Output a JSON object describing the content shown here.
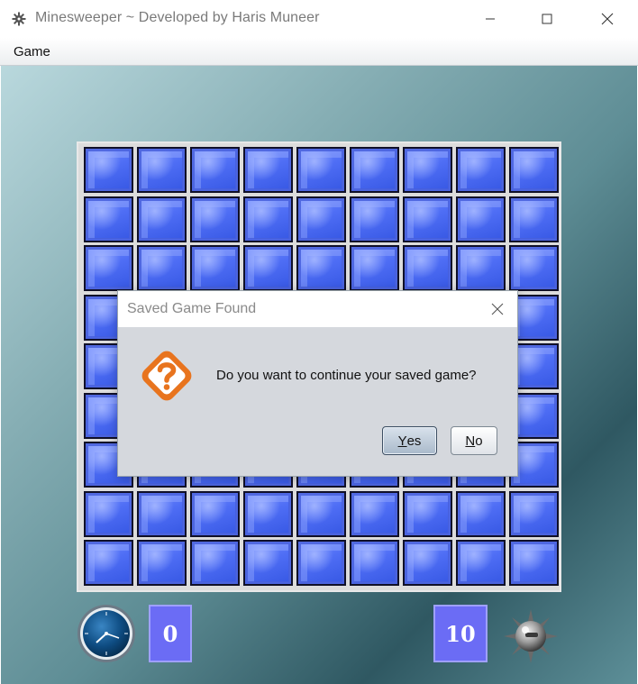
{
  "window": {
    "title": "Minesweeper ~ Developed by Haris Muneer",
    "icon": "gear-mine-icon"
  },
  "menu": {
    "items": [
      {
        "label": "Game"
      }
    ]
  },
  "board": {
    "rows": 9,
    "cols": 9,
    "tile_state": "covered",
    "tile_color": "#4f6ef5"
  },
  "status": {
    "timer_icon": "clock-icon",
    "time_value": "0",
    "mines_value": "10",
    "mine_icon": "mine-icon",
    "counter_color": "#6b6cf5"
  },
  "dialog": {
    "title": "Saved Game Found",
    "icon": "question-icon",
    "message": "Do you want to continue your saved game?",
    "yes_mnemonic": "Y",
    "yes_rest": "es",
    "no_mnemonic": "N",
    "no_rest": "o",
    "accent_color": "#e8741e"
  }
}
